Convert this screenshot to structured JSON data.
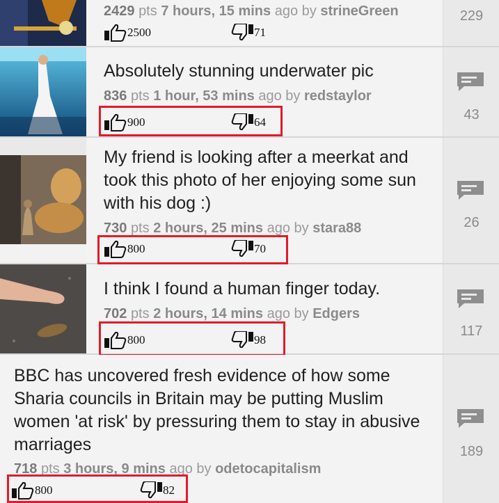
{
  "posts": [
    {
      "title": "",
      "points": "2429",
      "pts_label": "pts",
      "time": "7 hours, 15 mins",
      "ago_label": "ago by",
      "author": "strineGreen",
      "upvotes": "2500",
      "downvotes": "71",
      "comments": "229"
    },
    {
      "title": "Absolutely stunning underwater pic",
      "points": "836",
      "pts_label": "pts",
      "time": "1 hour, 53 mins",
      "ago_label": "ago by",
      "author": "redstaylor",
      "upvotes": "900",
      "downvotes": "64",
      "comments": "43"
    },
    {
      "title": "My friend is looking after a meerkat and took this photo of her enjoying some sun with his dog :)",
      "points": "730",
      "pts_label": "pts",
      "time": "2 hours, 25 mins",
      "ago_label": "ago by",
      "author": "stara88",
      "upvotes": "800",
      "downvotes": "70",
      "comments": "26"
    },
    {
      "title": "I think I found a human finger today.",
      "points": "702",
      "pts_label": "pts",
      "time": "2 hours, 14 mins",
      "ago_label": "ago by",
      "author": "Edgers",
      "upvotes": "800",
      "downvotes": "98",
      "comments": "117"
    },
    {
      "title": "BBC has uncovered fresh evidence of how some Sharia councils in Britain may be putting Muslim women 'at risk' by pressuring them to stay in abusive marriages",
      "points": "718",
      "pts_label": "pts",
      "time": "3 hours, 9 mins",
      "ago_label": "ago by",
      "author": "odetocapitalism",
      "upvotes": "800",
      "downvotes": "82",
      "comments": "189"
    }
  ],
  "icons": {
    "upvote": "thumbs-up-icon",
    "downvote": "thumbs-down-icon",
    "comments": "comment-icon"
  },
  "colors": {
    "highlight": "#e21b2a",
    "background": "#f3f3f3",
    "sidebar": "#e9e9e9"
  }
}
